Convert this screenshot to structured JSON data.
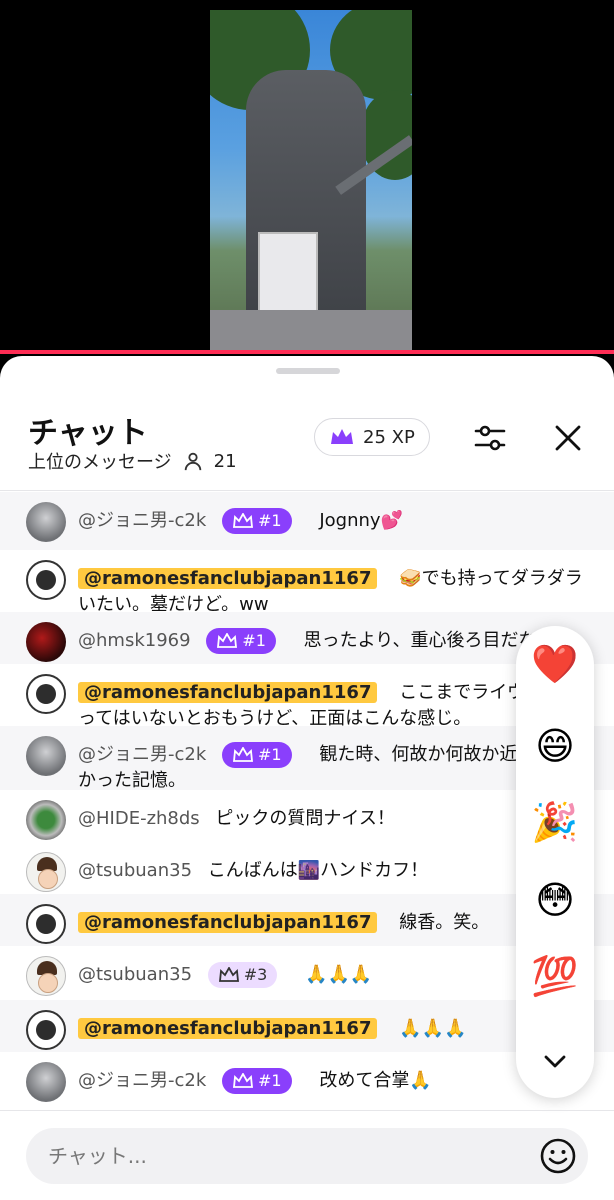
{
  "header": {
    "title": "チャット",
    "subtitle": "上位のメッセージ",
    "viewer_count": "21",
    "xp": "25 XP"
  },
  "messages": [
    {
      "user": "@ジョニ男-c2k",
      "highlight": false,
      "rank": "#1",
      "rank_style": "purple",
      "text": "Jognny💕",
      "avatar": "gray"
    },
    {
      "user": "@ramonesfanclubjapan1167",
      "highlight": true,
      "rank": null,
      "text": "🥪でも持ってダラダラいたい。墓だけど。ww",
      "avatar": "ramones"
    },
    {
      "user": "@hmsk1969",
      "highlight": false,
      "rank": "#1",
      "rank_style": "purple",
      "text": "思ったより、重心後ろ目だな。",
      "avatar": "red"
    },
    {
      "user": "@ramonesfanclubjapan1167",
      "highlight": true,
      "rank": null,
      "text": "ここまでライヴで斜めってはいないとおもうけど、正面はこんな感じ。",
      "avatar": "ramones"
    },
    {
      "user": "@ジョニ男-c2k",
      "highlight": false,
      "rank": "#1",
      "rank_style": "purple",
      "text": "観た時、何故か何故か近づけなかった記憶。",
      "avatar": "gray"
    },
    {
      "user": "@HIDE-zh8ds",
      "highlight": false,
      "rank": null,
      "text": "ピックの質問ナイス！",
      "avatar": "stadium"
    },
    {
      "user": "@tsubuan35",
      "highlight": false,
      "rank": null,
      "text": "こんばんは🌆ハンドカフ！",
      "avatar": "face"
    },
    {
      "user": "@ramonesfanclubjapan1167",
      "highlight": true,
      "rank": null,
      "text": "線香。笑。",
      "avatar": "ramones"
    },
    {
      "user": "@tsubuan35",
      "highlight": false,
      "rank": "#3",
      "rank_style": "light",
      "text": "🙏🙏🙏",
      "avatar": "face"
    },
    {
      "user": "@ramonesfanclubjapan1167",
      "highlight": true,
      "rank": null,
      "text": "🙏🙏🙏",
      "avatar": "ramones"
    },
    {
      "user": "@ジョニ男-c2k",
      "highlight": false,
      "rank": "#1",
      "rank_style": "purple",
      "text": "改めて合掌🙏",
      "avatar": "gray"
    }
  ],
  "reactions": [
    "❤️",
    "😄",
    "🎉",
    "😳",
    "💯"
  ],
  "input": {
    "placeholder": "チャット..."
  },
  "colors": {
    "accent": "#ff2d55",
    "rank_purple": "#8a3ffc",
    "highlight": "#ffc940"
  },
  "icons": {
    "viewers": "person-icon",
    "filter": "sliders-icon",
    "close": "close-icon",
    "emoji": "smiley-icon",
    "crown": "crown-icon",
    "collapse": "chevron-down-icon"
  }
}
